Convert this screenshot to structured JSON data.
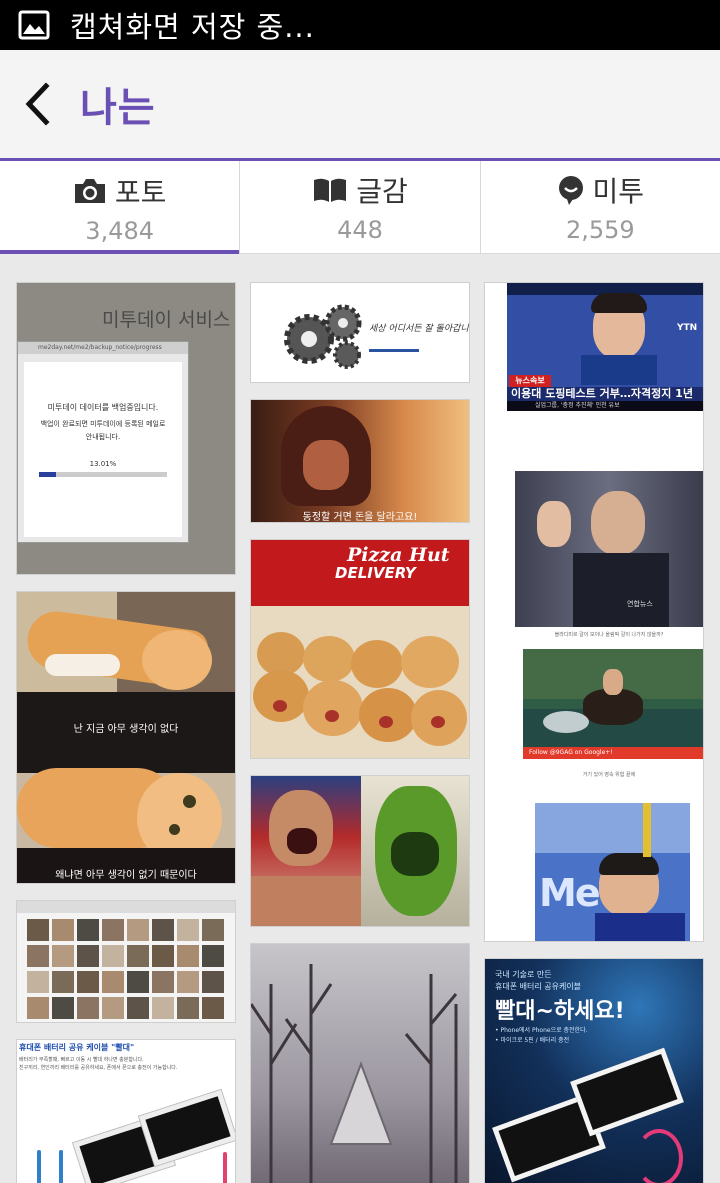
{
  "status_bar": {
    "text": "캡쳐화면 저장 중..."
  },
  "header": {
    "title": "나는"
  },
  "tabs": [
    {
      "label": "포토",
      "count": "3,484",
      "icon": "camera-icon",
      "active": true
    },
    {
      "label": "글감",
      "count": "448",
      "icon": "book-icon",
      "active": false
    },
    {
      "label": "미투",
      "count": "2,559",
      "icon": "speech-bubble-icon",
      "active": false
    }
  ],
  "photos": {
    "backup": {
      "title": "미투데이 서비스 종료 데이터 백업 안내",
      "url": "me2day.net/me2/backup_notice/progress",
      "line1": "미투데이 데이터를 백업중입니다.",
      "line2": "백업이 완료되면 미투데이에 등록된 메일로",
      "line3": "안내됩니다.",
      "percent": "13.01%",
      "progress": 0.1301
    },
    "gears": {
      "text": "세상 어디서든 잘 돌아갑니다"
    },
    "girl": {
      "caption": "동정할 거면 돈을 달라고요!"
    },
    "pizza": {
      "brand": "Pizza Hut",
      "sub": "DELIVERY"
    },
    "cat": {
      "caption_top": "난 지금 아무 생각이 없다",
      "caption_bottom": "왜냐면 아무 생각이 없기 때문이다"
    },
    "news": {
      "badge": "뉴스속보",
      "channel": "YTN",
      "headline": "이용대 도핑테스트 거부…자격정지 1년",
      "sub": "실업그룹, '충정 추진체' 인천 유보"
    },
    "putin": {
      "watermark": "연합뉴스",
      "caption": "블라디미르 갈이 보이나 올림픽 갈이 나가지 않을까?",
      "follow": "Follow @9GAG on Google+!",
      "caption2": "거기 있어 영속 위험 끝에"
    },
    "battery_left": {
      "title": "휴대폰 배터리 공유 케이블 \"빨대\"",
      "desc1": "배터리가 부족할때, 빠르고 이동 시 빨대 하나면 충분합니다.",
      "desc2": "친구끼리, 연인끼리 배터리를 공유하세요, 폰에서 폰으로 충전이 가능합니다."
    },
    "battery_right": {
      "top1": "국내 기술로 만든",
      "top2": "휴대폰 배터리 공유케이블",
      "headline": "빨대~하세요!",
      "bullet1": "• Phone에서 Phone으로 충전한다.",
      "bullet2": "• 마이크로 5핀 / 배터리 충전"
    }
  }
}
